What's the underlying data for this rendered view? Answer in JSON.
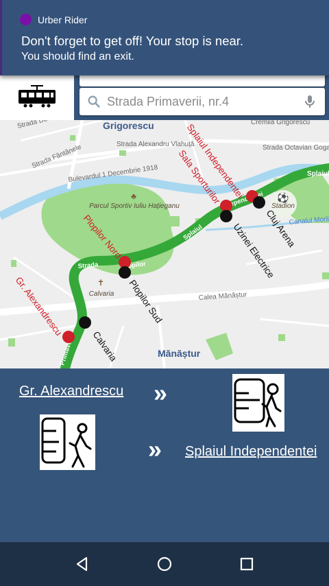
{
  "notification": {
    "app_name": "Urber Rider",
    "title": "Don't forget to get off! Your stop is near.",
    "body": "You should find an exit."
  },
  "search": {
    "destination": "Strada Primaverii, nr.4"
  },
  "map": {
    "neighborhoods": [
      "Grigorescu",
      "Mănăștur"
    ],
    "streets": [
      "Strada Alexandru Vlahuță",
      "Strada Fântânele",
      "Bulevardul 1 Decembrie 1918",
      "Strada Octavian Goga",
      "Calea Mănăștur",
      "Strada Plopilor",
      "Splaiul Independenței",
      "Strada Primaverii",
      "Canalul Morii",
      "Cremiia Grigorescu",
      "Splaiul",
      "Strada Do"
    ],
    "places": [
      "Parcul Sportiv Iuliu Hațieganu",
      "Calvaria",
      "Stadion"
    ],
    "road_labels_on_route": [
      "Strada",
      "Plopilor",
      "Splaiul",
      "Independentei",
      "Primaveri"
    ],
    "stations_red": [
      "Gr. Alexandrescu",
      "Plopilor Nord",
      "Sala Sporturilor",
      "Splaiul Independentei"
    ],
    "stations_black": [
      "Calvaria",
      "Plopilor Sud",
      "Uzinei Electrice",
      "Cluj Arena"
    ],
    "colors": {
      "route": "#35a83a",
      "park": "#9fd98b",
      "water": "#a8d7f0",
      "stop_red": "#d0202a",
      "stop_black": "#111111",
      "station_label_red": "#d0202a"
    }
  },
  "trip": {
    "from_stop": "Gr. Alexandrescu",
    "to_stop": "Splaiul Independentei",
    "chevron": "»",
    "board_icon": "bus-boarding-icon",
    "exit_icon": "bus-exit-icon"
  },
  "navbar": {
    "back": "back-icon",
    "home": "home-icon",
    "recents": "recents-icon"
  }
}
